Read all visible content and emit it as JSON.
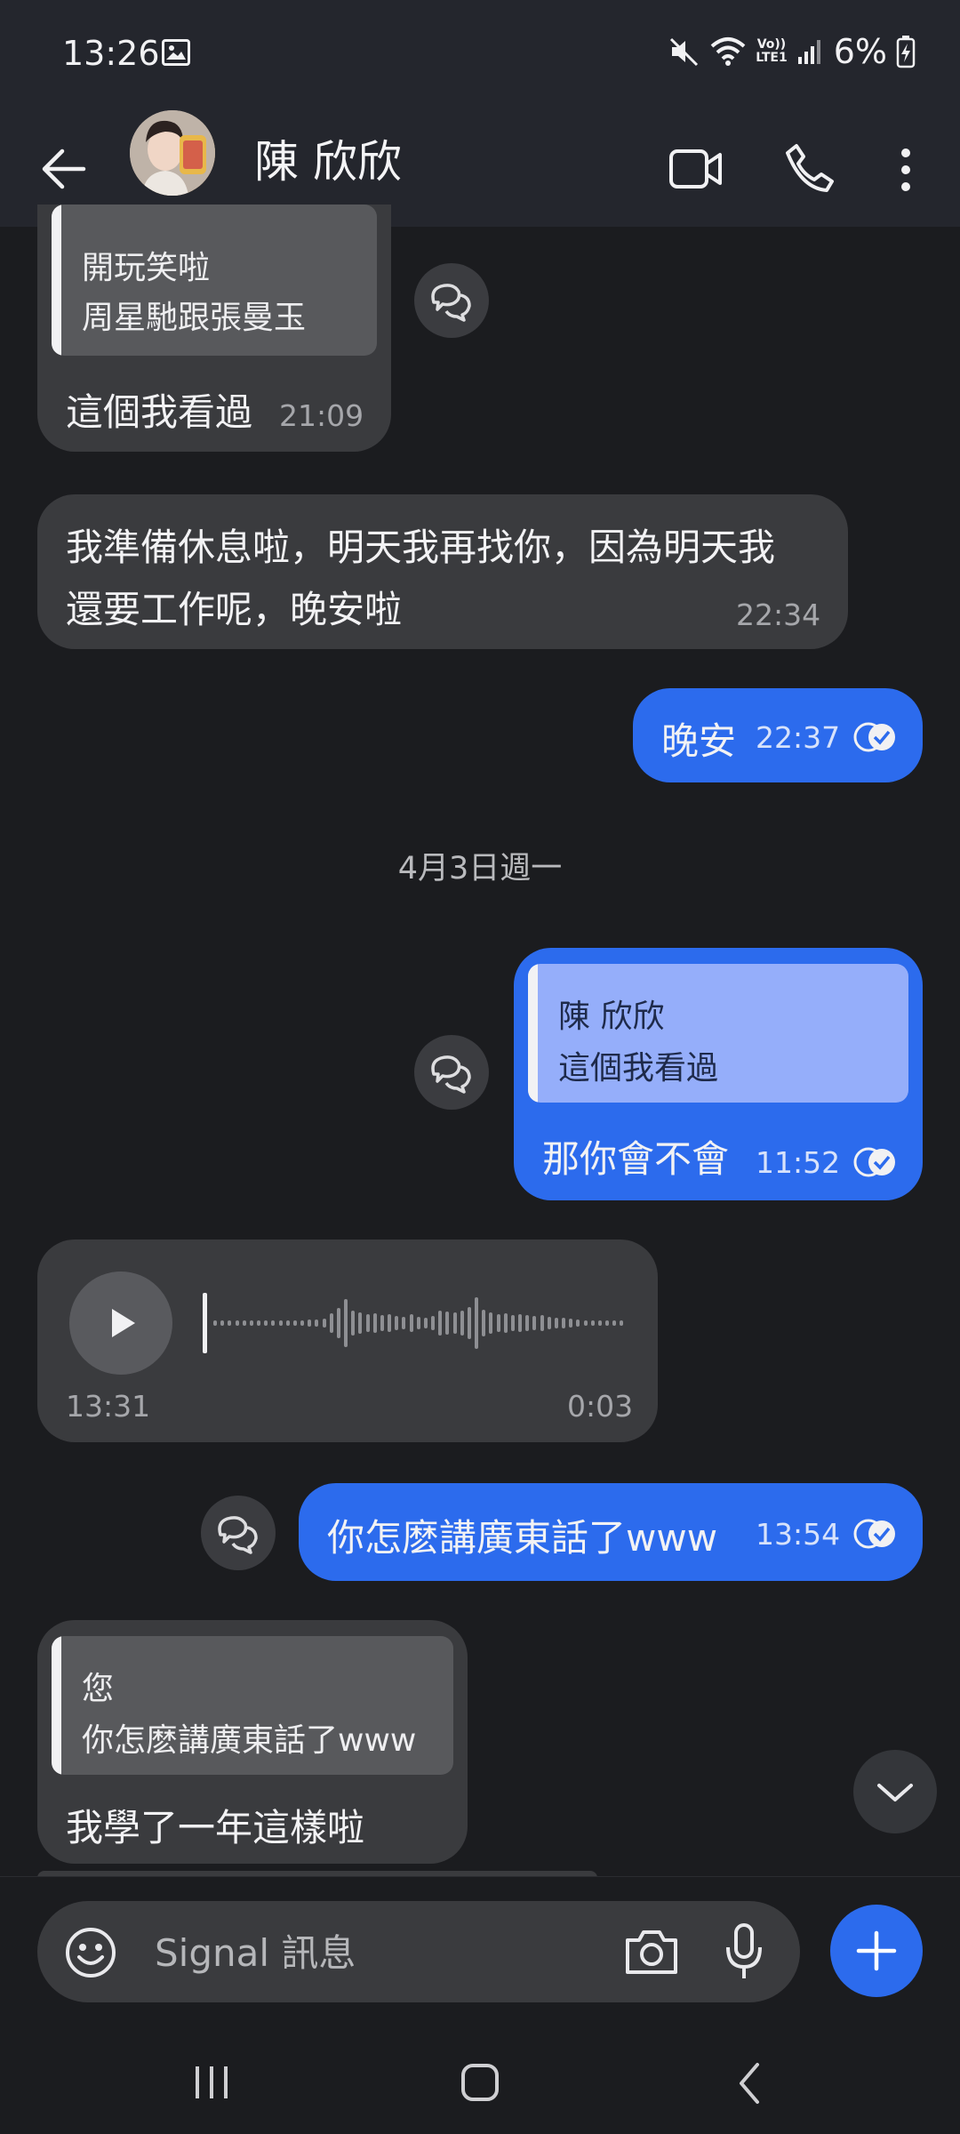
{
  "status_bar": {
    "time": "13:26",
    "battery": "6%",
    "network_top": "Vo))",
    "network_bottom": "LTE1"
  },
  "header": {
    "contact_name": "陳 欣欣"
  },
  "messages": [
    {
      "direction": "incoming",
      "quote_text_line1": "開玩笑啦",
      "quote_text_line2": "周星馳跟張曼玉",
      "text": "這個我看過",
      "time": "21:09"
    },
    {
      "direction": "incoming",
      "text_line1": "我準備休息啦，明天我再找你，因為明天我",
      "text_line2": "還要工作呢，晚安啦",
      "time": "22:34"
    },
    {
      "direction": "outgoing",
      "text": "晚安",
      "time": "22:37"
    },
    {
      "direction": "outgoing",
      "quote_author": "陳 欣欣",
      "quote_text": "這個我看過",
      "text": "那你會不會",
      "time": "11:52"
    },
    {
      "direction": "incoming",
      "type": "voice",
      "time": "13:31",
      "duration": "0:03"
    },
    {
      "direction": "outgoing",
      "text": "你怎麽講廣東話了www",
      "time": "13:54"
    },
    {
      "direction": "incoming",
      "quote_author": "您",
      "quote_text": "你怎麽講廣東話了www",
      "text": "我學了一年這樣啦"
    }
  ],
  "date_separator": "4月3日週一",
  "composer": {
    "placeholder": "Signal 訊息"
  },
  "icons": {
    "back": "back-arrow-icon",
    "video": "video-call-icon",
    "phone": "phone-call-icon",
    "more": "more-vert-icon",
    "reply": "reply-icon",
    "play": "play-icon",
    "scroll_down": "chevron-down-icon",
    "emoji": "emoji-icon",
    "camera": "camera-icon",
    "mic": "mic-icon",
    "plus": "plus-icon",
    "read": "read-receipt-icon"
  },
  "colors": {
    "outgoing_bubble": "#2c6bed",
    "incoming_bubble": "#3a3b3e",
    "background": "#1b1c1f",
    "header": "#24262d"
  }
}
